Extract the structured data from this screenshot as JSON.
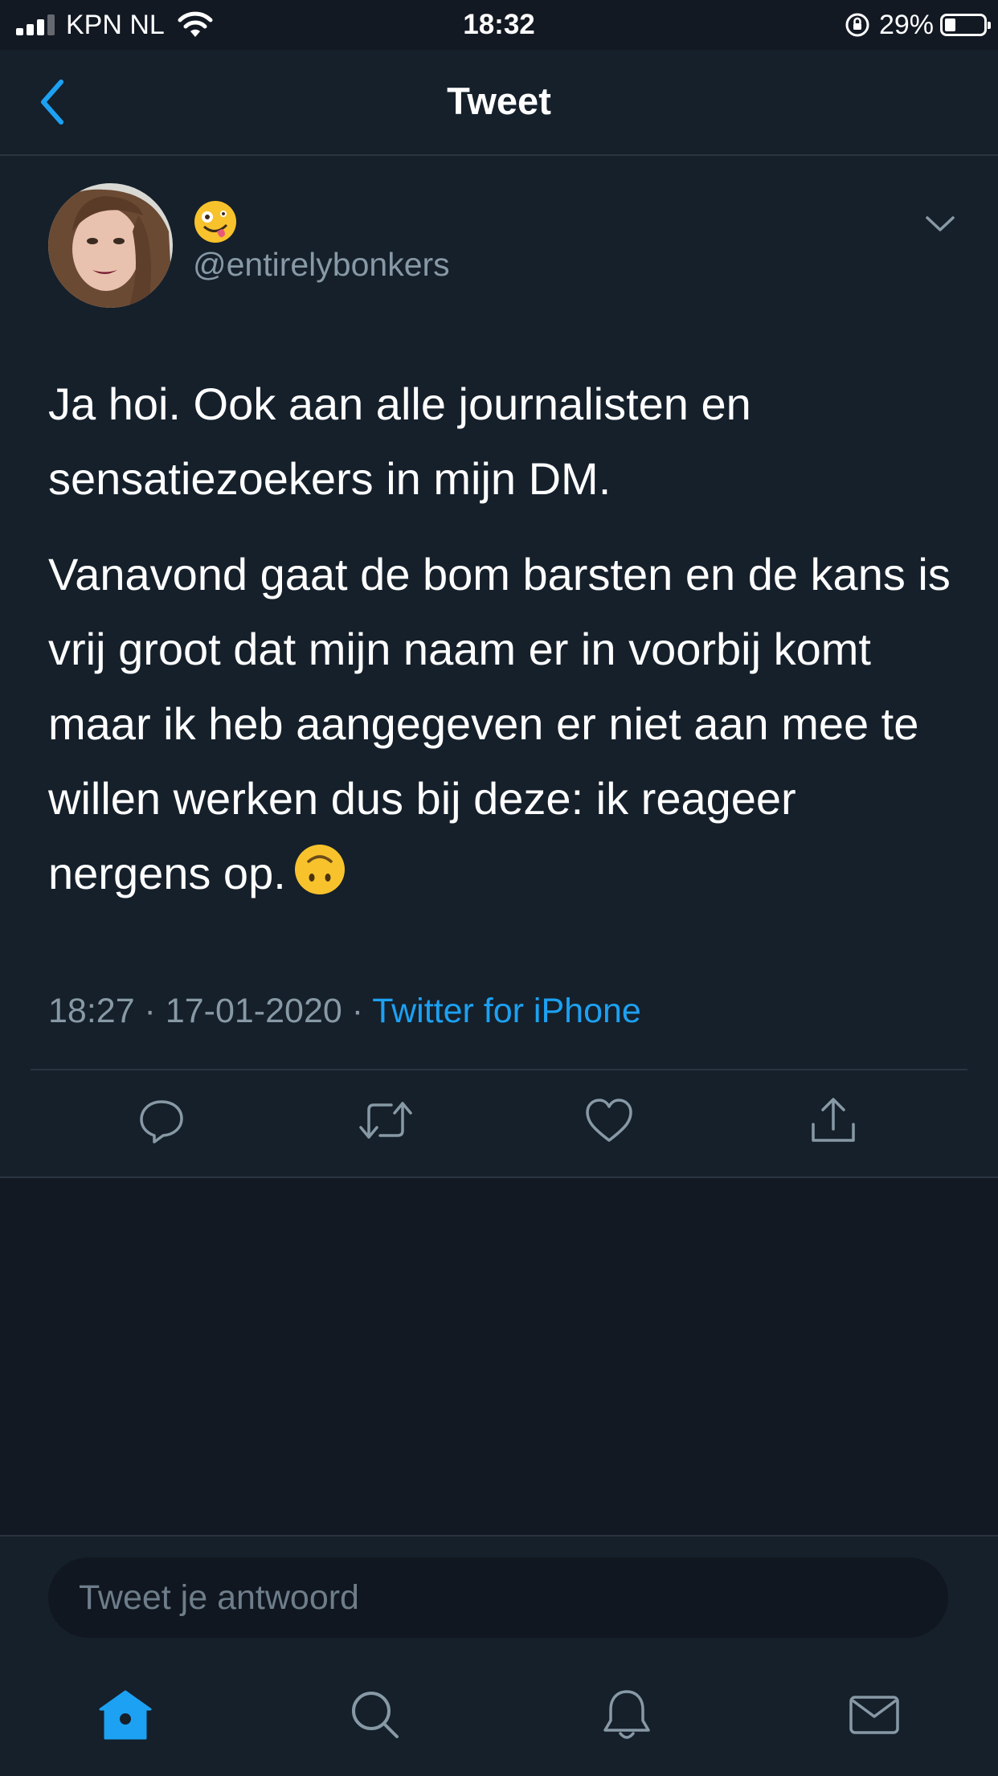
{
  "status_bar": {
    "carrier": "KPN NL",
    "time": "18:32",
    "battery_percent": "29%",
    "battery_level": 0.29
  },
  "nav": {
    "title": "Tweet",
    "back_icon": "chevron-left-icon"
  },
  "tweet": {
    "display_name_emoji": "zany-face-emoji",
    "handle": "@entirelybonkers",
    "paragraphs": [
      "Ja hoi. Ook aan alle journalisten en sensatiezoekers in mijn DM.",
      "Vanavond gaat de bom barsten en de kans is vrij groot dat mijn naam er in voorbij komt maar ik heb aangegeven er niet aan mee te willen werken dus bij deze: ik reageer nergens op."
    ],
    "trailing_emoji": "upside-down-face-emoji",
    "time": "18:27",
    "date": "17-01-2020",
    "source": "Twitter for iPhone"
  },
  "actions": [
    "reply-icon",
    "retweet-icon",
    "like-icon",
    "share-icon"
  ],
  "reply": {
    "placeholder": "Tweet je antwoord"
  },
  "tabbar": [
    "home-icon",
    "search-icon",
    "notifications-icon",
    "messages-icon"
  ],
  "colors": {
    "background": "#15202b",
    "accent": "#1da1f2",
    "muted": "#8899a6"
  }
}
